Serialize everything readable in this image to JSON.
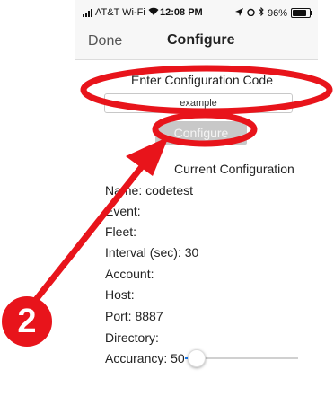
{
  "status_bar": {
    "carrier": "AT&T Wi-Fi",
    "time": "12:08 PM",
    "battery": "96%",
    "battery_level": 0.96
  },
  "nav": {
    "done_label": "Done",
    "title": "Configure"
  },
  "config_code": {
    "label": "Enter Configuration Code",
    "value": "example",
    "button_label": "Configure"
  },
  "current_config": {
    "title": "Current Configuration",
    "fields": {
      "name": "Name: codetest",
      "event": "Event:",
      "fleet": "Fleet:",
      "interval": "Interval (sec): 30",
      "account": "Account:",
      "host": "Host:",
      "port": "Port: 8887",
      "directory": "Directory:",
      "accuracy": "Accurancy: 50"
    }
  },
  "accuracy_slider": {
    "value_fraction": 0.1
  },
  "annotation": {
    "step_number": "2",
    "color": "#e8141b"
  },
  "colors": {
    "tint": "#1b7df2",
    "button_disabled": "#c8c8c8"
  }
}
